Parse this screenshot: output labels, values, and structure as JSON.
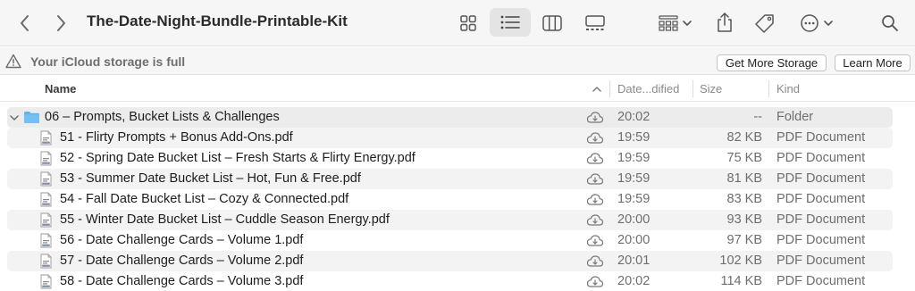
{
  "window": {
    "title": "The-Date-Night-Bundle-Printable-Kit"
  },
  "toolbar": {
    "back_icon": "chevron-left-icon",
    "forward_icon": "chevron-right-icon",
    "view_modes": [
      "icon-view",
      "list-view",
      "column-view",
      "gallery-view"
    ],
    "selected_view": "list-view",
    "group_icon": "group-by-icon",
    "share_icon": "share-icon",
    "tag_icon": "tag-icon",
    "more_icon": "ellipsis-circle-icon",
    "search_icon": "search-icon"
  },
  "banner": {
    "message": "Your iCloud storage is full",
    "get_more_label": "Get More Storage",
    "learn_more_label": "Learn More"
  },
  "columns": {
    "name": "Name",
    "date": "Date...dified",
    "size": "Size",
    "kind": "Kind"
  },
  "folder": {
    "name": "06 – Prompts, Bucket Lists & Challenges",
    "date": "20:02",
    "size": "--",
    "kind": "Folder",
    "expanded": true
  },
  "files": [
    {
      "name": "51 - Flirty Prompts + Bonus Add-Ons.pdf",
      "date": "19:59",
      "size": "82 KB",
      "kind": "PDF Document"
    },
    {
      "name": "52 - Spring Date Bucket List – Fresh Starts & Flirty Energy.pdf",
      "date": "19:59",
      "size": "75 KB",
      "kind": "PDF Document"
    },
    {
      "name": "53 - Summer Date Bucket List – Hot, Fun & Free.pdf",
      "date": "19:59",
      "size": "81 KB",
      "kind": "PDF Document"
    },
    {
      "name": "54 - Fall Date Bucket List – Cozy & Connected.pdf",
      "date": "19:59",
      "size": "83 KB",
      "kind": "PDF Document"
    },
    {
      "name": "55 - Winter Date Bucket List – Cuddle Season Energy.pdf",
      "date": "20:00",
      "size": "93 KB",
      "kind": "PDF Document"
    },
    {
      "name": "56 - Date Challenge Cards – Volume 1.pdf",
      "date": "20:00",
      "size": "97 KB",
      "kind": "PDF Document"
    },
    {
      "name": "57 - Date Challenge Cards – Volume 2.pdf",
      "date": "20:01",
      "size": "102 KB",
      "kind": "PDF Document"
    },
    {
      "name": "58 - Date Challenge Cards – Volume 3.pdf",
      "date": "20:02",
      "size": "114 KB",
      "kind": "PDF Document"
    }
  ],
  "colors": {
    "toolbar_bg": "#f6f6f6",
    "folder_blue": "#5fb2ee",
    "row_alt": "#f3f3f3",
    "secondary_text": "#6e6e6e"
  }
}
